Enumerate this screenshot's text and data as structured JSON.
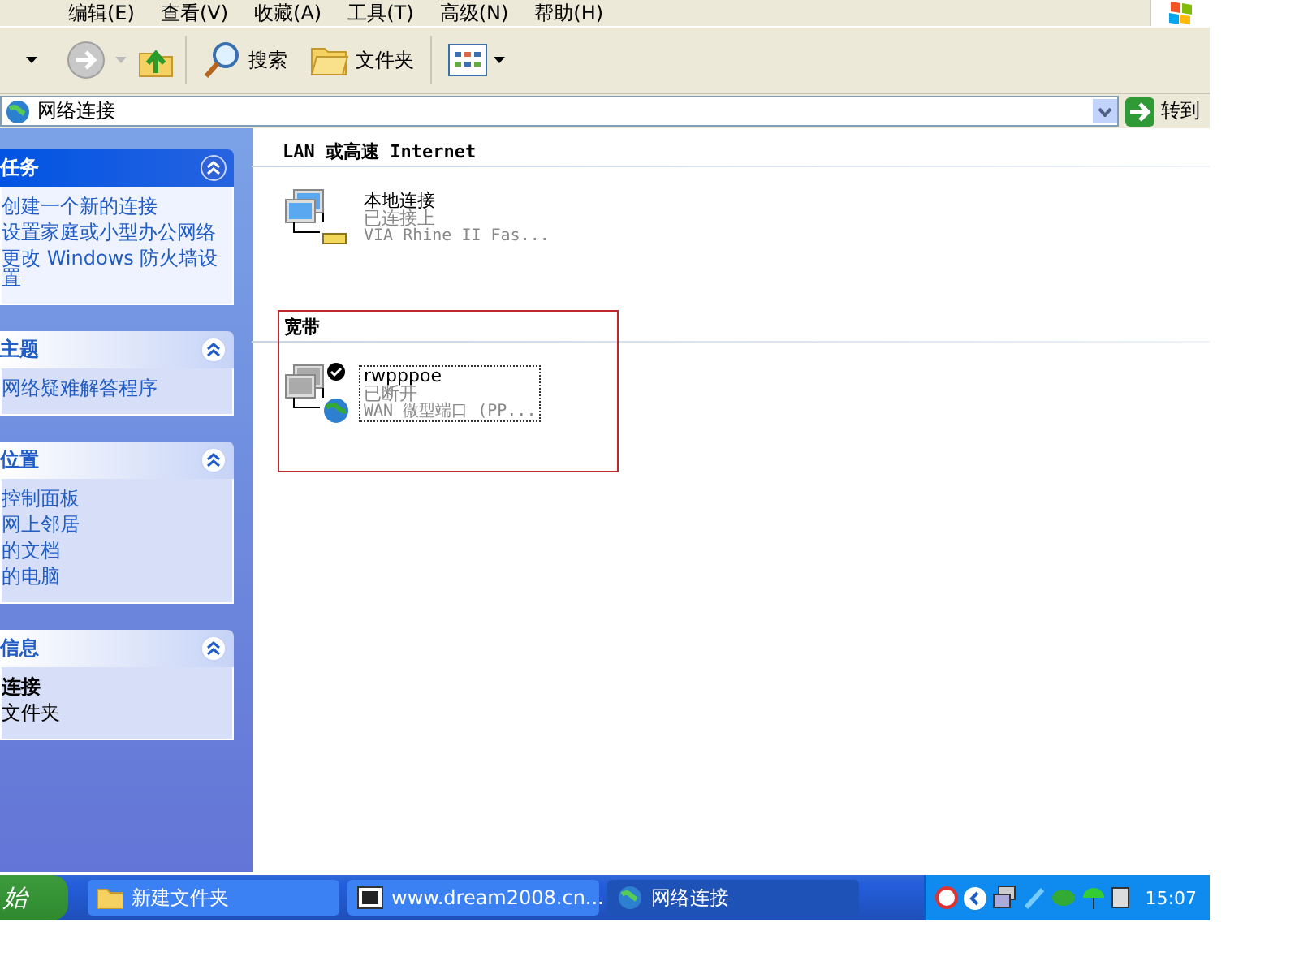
{
  "menu": [
    {
      "label": "编辑(E)"
    },
    {
      "label": "查看(V)"
    },
    {
      "label": "收藏(A)"
    },
    {
      "label": "工具(T)"
    },
    {
      "label": "高级(N)"
    },
    {
      "label": "帮助(H)"
    }
  ],
  "toolbar": {
    "forward_disabled": true,
    "buttons": [
      {
        "kind": "search",
        "label": "搜索"
      },
      {
        "kind": "folders",
        "label": "文件夹"
      }
    ]
  },
  "address": {
    "value": "网络连接",
    "go": "转到"
  },
  "taskpane": [
    {
      "title": "任务",
      "kind": "special",
      "links": [
        "创建一个新的连接",
        "设置家庭或小型办公网络",
        "更改 Windows 防火墙设置"
      ]
    },
    {
      "title": "主题",
      "kind": "normal",
      "links": [
        "网络疑难解答程序"
      ]
    },
    {
      "title": "位置",
      "kind": "normal",
      "links": [
        "控制面板",
        "网上邻居",
        "的文档",
        "的电脑"
      ]
    },
    {
      "title": "信息",
      "kind": "details",
      "lines": [
        {
          "text": "连接",
          "emphasis": true
        },
        {
          "text": "文件夹",
          "emphasis": false
        }
      ]
    }
  ],
  "groups": [
    {
      "title": "LAN 或高速 Internet",
      "highlighted": false,
      "connections": [
        {
          "kind": "lan",
          "name": "本地连接",
          "status": "已连接上",
          "device": "VIA Rhine II Fas...",
          "selected": false
        }
      ]
    },
    {
      "title": "宽带",
      "highlighted": true,
      "connections": [
        {
          "kind": "broadband",
          "name": "rwpppoe",
          "status": "已断开",
          "device": "WAN 微型端口 (PP...",
          "selected": true
        }
      ]
    }
  ],
  "taskbar": {
    "start": "始",
    "tasks": [
      {
        "kind": "folder",
        "label": "新建文件夹",
        "selected": false
      },
      {
        "kind": "browser",
        "label": "www.dream2008.cn...",
        "selected": false
      },
      {
        "kind": "network",
        "label": "网络连接",
        "selected": true
      }
    ],
    "clock": "15:07"
  }
}
